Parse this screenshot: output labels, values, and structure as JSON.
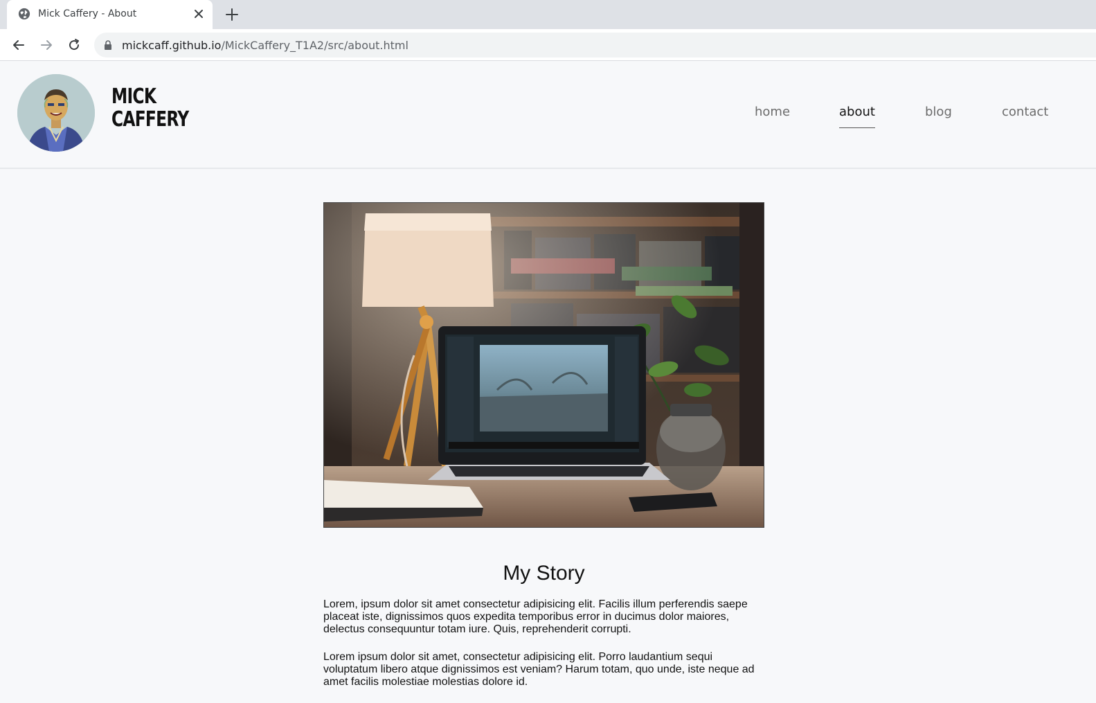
{
  "browser": {
    "tab_title": "Mick Caffery - About",
    "url_host": "mickcaff.github.io",
    "url_path": "/MickCaffery_T1A2/src/about.html"
  },
  "site": {
    "brand_line1": "MICK",
    "brand_line2": "CAFFERY",
    "nav": [
      {
        "label": "home",
        "active": false
      },
      {
        "label": "about",
        "active": true
      },
      {
        "label": "blog",
        "active": false
      },
      {
        "label": "contact",
        "active": false
      }
    ]
  },
  "main": {
    "heading": "My Story",
    "paragraphs": [
      "Lorem, ipsum dolor sit amet consectetur adipisicing elit. Facilis illum perferendis saepe placeat iste, dignissimos quos expedita temporibus error in ducimus dolor maiores, delectus consequuntur totam iure. Quis, reprehenderit corrupti.",
      "Lorem ipsum dolor sit amet, consectetur adipisicing elit. Porro laudantium sequi voluptatum libero atque dignissimos est veniam? Harum totam, quo unde, iste neque ad amet facilis molestiae molestias dolore id."
    ]
  },
  "colors": {
    "page_bg": "#f7f8fa",
    "nav_active": "#111111",
    "nav_inactive": "#6b6b6b"
  }
}
